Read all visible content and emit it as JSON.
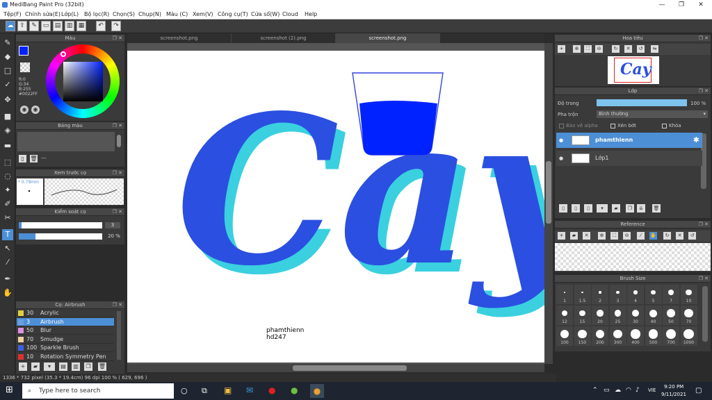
{
  "window": {
    "title": "MediBang Paint Pro (32bit)",
    "min": "—",
    "max": "❐",
    "close": "✕"
  },
  "menu": [
    "Tệp(F)",
    "Chỉnh sửa(E)",
    "Lớp(L)",
    "Bộ lọc(R)",
    "Chọn(S)",
    "Chụp(N)",
    "Màu (C)",
    "Xem(V)",
    "Công cụ(T)",
    "Cửa sổ(W)",
    "Cloud",
    "Help"
  ],
  "tabs": [
    "screenshot.png",
    "screenshot (2).png",
    "screenshot.png"
  ],
  "color_panel": {
    "title": "Màu",
    "r": "R:0",
    "g": "G:34",
    "b": "B:255",
    "hex": "#0022FF"
  },
  "palette_panel": {
    "title": "Bảng màu",
    "dash": "---"
  },
  "brush_preview": {
    "title": "Xem trước cọ",
    "size": "* 0.79mm"
  },
  "brush_control": {
    "title": "Kiểm soát cọ",
    "size_value": "3",
    "opacity_value": "20 %",
    "size_fraction": 0.03,
    "opacity_fraction": 0.2
  },
  "brush_list": {
    "title": "Cọ: Airbrush",
    "items": [
      {
        "num": "30",
        "name": "Acrylic",
        "color": "#e0d040"
      },
      {
        "num": "3",
        "name": "Airbrush",
        "color": "#6aa0e0"
      },
      {
        "num": "50",
        "name": "Blur",
        "color": "#e090e0"
      },
      {
        "num": "70",
        "name": "Smudge",
        "color": "#f0d0a0"
      },
      {
        "num": "100",
        "name": "Sparkle Brush",
        "color": "#4060e0"
      },
      {
        "num": "10",
        "name": "Rotation Symmetry Pen",
        "color": "#e03030"
      }
    ]
  },
  "artwork": {
    "word": "Cay",
    "credit_line1": "phamthienn",
    "credit_line2": "hd247",
    "main_color": "#2b4fe0",
    "shadow_color": "#3ad0e0"
  },
  "navigator": {
    "title": "Hoa tiêu"
  },
  "layers_panel": {
    "title": "Lớp",
    "opacity_label": "Độ trong",
    "opacity_value": "100 %",
    "blend_label": "Pha trộn",
    "blend_value": "Bình thường",
    "alpha_label": "Bảo vệ alpha",
    "clip_label": "Xén bớt",
    "lock_label": "Khóa",
    "layers": [
      {
        "name": "phamthienn",
        "selected": true
      },
      {
        "name": "Lớp1",
        "selected": false
      }
    ]
  },
  "reference": {
    "title": "Reference"
  },
  "brush_size": {
    "title": "Brush Size",
    "rows": [
      [
        "1",
        "1.5",
        "2",
        "3",
        "4",
        "5",
        "7",
        "10"
      ],
      [
        "12",
        "15",
        "20",
        "25",
        "30",
        "40",
        "50",
        "70"
      ],
      [
        "100",
        "150",
        "200",
        "300",
        "400",
        "500",
        "700",
        "1000"
      ]
    ]
  },
  "status": {
    "text": "1336 * 732 pixel  (35.3 * 19.4cm)  96 dpi  100 %  ( 629, 696 )"
  },
  "taskbar": {
    "search_placeholder": "Type here to search",
    "time": "9:20 PM",
    "date": "9/11/2021",
    "lang": "VIE"
  }
}
